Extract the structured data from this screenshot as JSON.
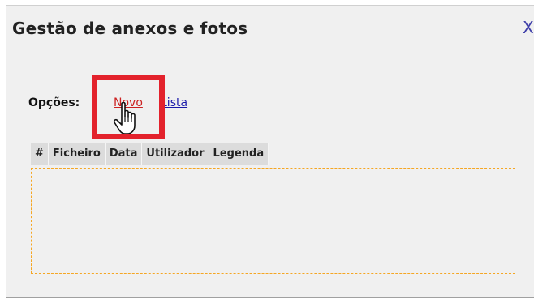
{
  "dialog": {
    "title": "Gestão de anexos e fotos",
    "close_label": "X"
  },
  "options": {
    "label": "Opções:",
    "links": [
      {
        "label": "Novo",
        "state": "hover"
      },
      {
        "label": "Lista"
      }
    ]
  },
  "table": {
    "columns": [
      "#",
      "Ficheiro",
      "Data",
      "Utilizador",
      "Legenda"
    ],
    "rows": []
  },
  "colors": {
    "highlight": "#e3222c",
    "link_active": "#cc2222",
    "link": "#1a1aaa",
    "dropzone_border": "#f5a623"
  },
  "icons": {
    "cursor": "hand-pointer-icon"
  }
}
